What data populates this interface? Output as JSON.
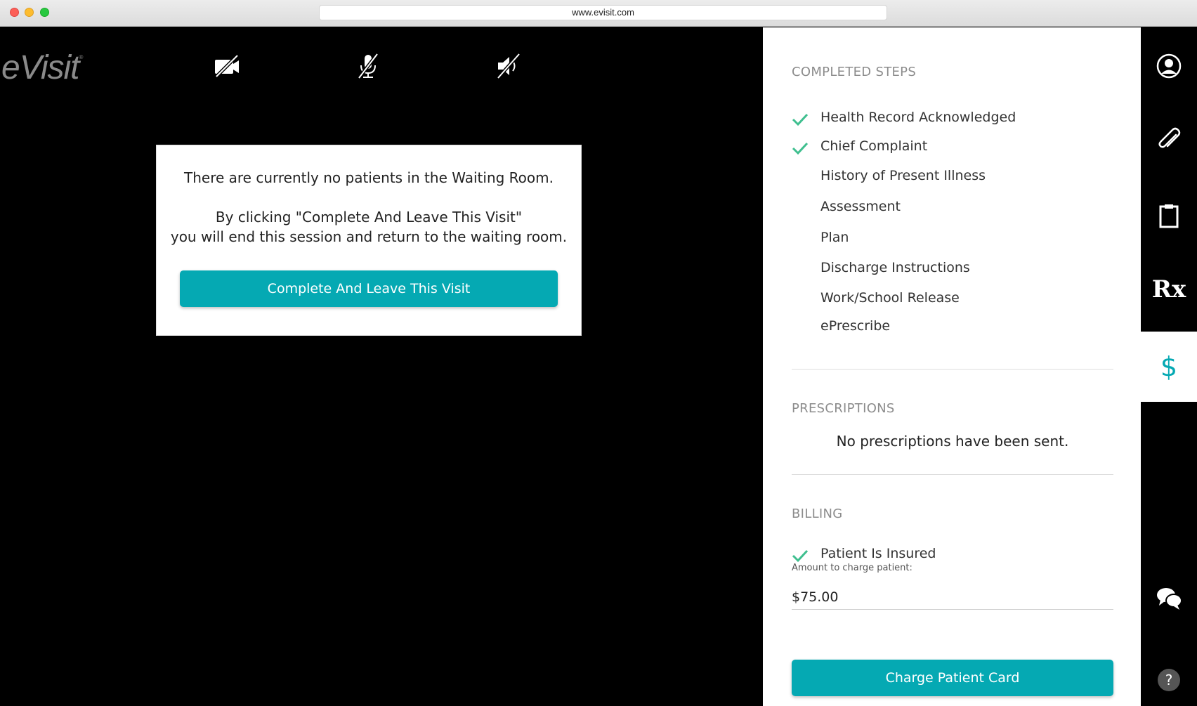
{
  "browser": {
    "url": "www.evisit.com"
  },
  "app": {
    "logo_text": "eVisit",
    "logo_mark": "®"
  },
  "controls": [
    {
      "name": "camera-off-icon"
    },
    {
      "name": "microphone-off-icon"
    },
    {
      "name": "speaker-off-icon"
    }
  ],
  "modal": {
    "message": "There are currently no patients in the Waiting Room.",
    "instruction_line1": "By clicking \"Complete And Leave This Visit\"",
    "instruction_line2": "you will end this session and return to the waiting room.",
    "button_label": "Complete And Leave This Visit"
  },
  "completed_steps": {
    "title": "COMPLETED STEPS",
    "items": [
      {
        "label": "Health Record Acknowledged",
        "done": true
      },
      {
        "label": "Chief Complaint",
        "done": true
      },
      {
        "label": "History of Present Illness",
        "done": false
      },
      {
        "label": "Assessment",
        "done": false
      },
      {
        "label": "Plan",
        "done": false
      },
      {
        "label": "Discharge Instructions",
        "done": false
      },
      {
        "label": "Work/School Release",
        "done": false
      },
      {
        "label": "ePrescribe",
        "done": false
      }
    ]
  },
  "prescriptions": {
    "title": "PRESCRIPTIONS",
    "empty_message": "No prescriptions have been sent."
  },
  "billing": {
    "title": "BILLING",
    "insured_label": "Patient Is Insured",
    "insured": true,
    "amount_label": "Amount to charge patient:",
    "amount_value": "$75.00",
    "charge_button": "Charge Patient Card"
  },
  "rail": {
    "items": [
      {
        "name": "profile-icon"
      },
      {
        "name": "attachment-icon"
      },
      {
        "name": "clipboard-icon"
      },
      {
        "name": "rx-icon",
        "text": "Rx"
      },
      {
        "name": "billing-icon",
        "text": "$",
        "active": true
      },
      {
        "name": "chat-icon"
      },
      {
        "name": "help-icon",
        "text": "?"
      }
    ]
  },
  "colors": {
    "accent": "#05a9b3",
    "check": "#3fbf8f"
  }
}
